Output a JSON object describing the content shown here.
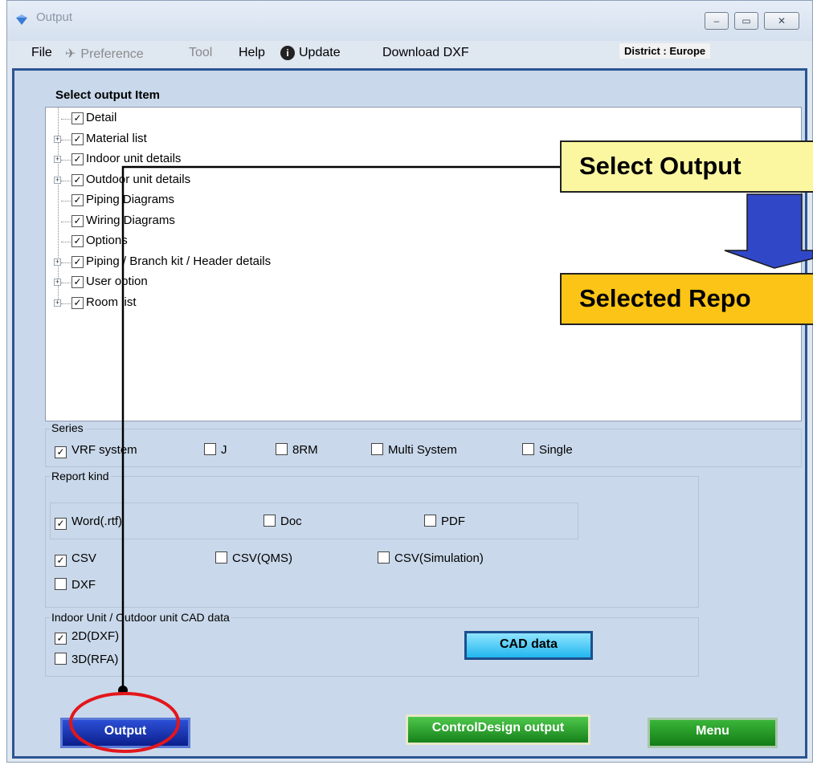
{
  "window": {
    "title": "Output",
    "minimize": "‒",
    "maximize": "▭",
    "close": "✕"
  },
  "menubar": {
    "file": "File",
    "preference": "Preference",
    "tool": "Tool",
    "help": "Help",
    "update": "Update",
    "download": "Download DXF",
    "district": "District : Europe"
  },
  "select_title": "Select output Item",
  "tree": [
    {
      "label": "Detail",
      "expandable": false
    },
    {
      "label": "Material list",
      "expandable": true
    },
    {
      "label": "Indoor unit details",
      "expandable": true
    },
    {
      "label": "Outdoor unit details",
      "expandable": true
    },
    {
      "label": "Piping Diagrams",
      "expandable": false
    },
    {
      "label": "Wiring Diagrams",
      "expandable": false
    },
    {
      "label": "Options",
      "expandable": false
    },
    {
      "label": "Piping / Branch kit / Header details",
      "expandable": true
    },
    {
      "label": "User option",
      "expandable": true
    },
    {
      "label": "Room list",
      "expandable": true
    }
  ],
  "series": {
    "title": "Series",
    "options": [
      {
        "label": "VRF system",
        "checked": true
      },
      {
        "label": "J",
        "checked": false
      },
      {
        "label": "8RM",
        "checked": false
      },
      {
        "label": "Multi System",
        "checked": false
      },
      {
        "label": "Single",
        "checked": false
      }
    ]
  },
  "report": {
    "title": "Report kind",
    "word": {
      "label": "Word(.rtf)",
      "checked": true
    },
    "doc": {
      "label": "Doc",
      "checked": false
    },
    "pdf": {
      "label": "PDF",
      "checked": false
    },
    "csv": {
      "label": "CSV",
      "checked": true
    },
    "csv_qms": {
      "label": "CSV(QMS)",
      "checked": false
    },
    "csv_sim": {
      "label": "CSV(Simulation)",
      "checked": false
    },
    "dxf": {
      "label": "DXF",
      "checked": false
    }
  },
  "cad": {
    "title": "Indoor Unit / Outdoor unit CAD data",
    "d2": {
      "label": "2D(DXF)",
      "checked": true
    },
    "d3": {
      "label": "3D(RFA)",
      "checked": false
    },
    "button": "CAD data"
  },
  "buttons": {
    "output": "Output",
    "control": "ControlDesign output",
    "menu": "Menu"
  },
  "callouts": {
    "select": "Select Output",
    "selected": "Selected Repo"
  },
  "check_mark": "✓"
}
